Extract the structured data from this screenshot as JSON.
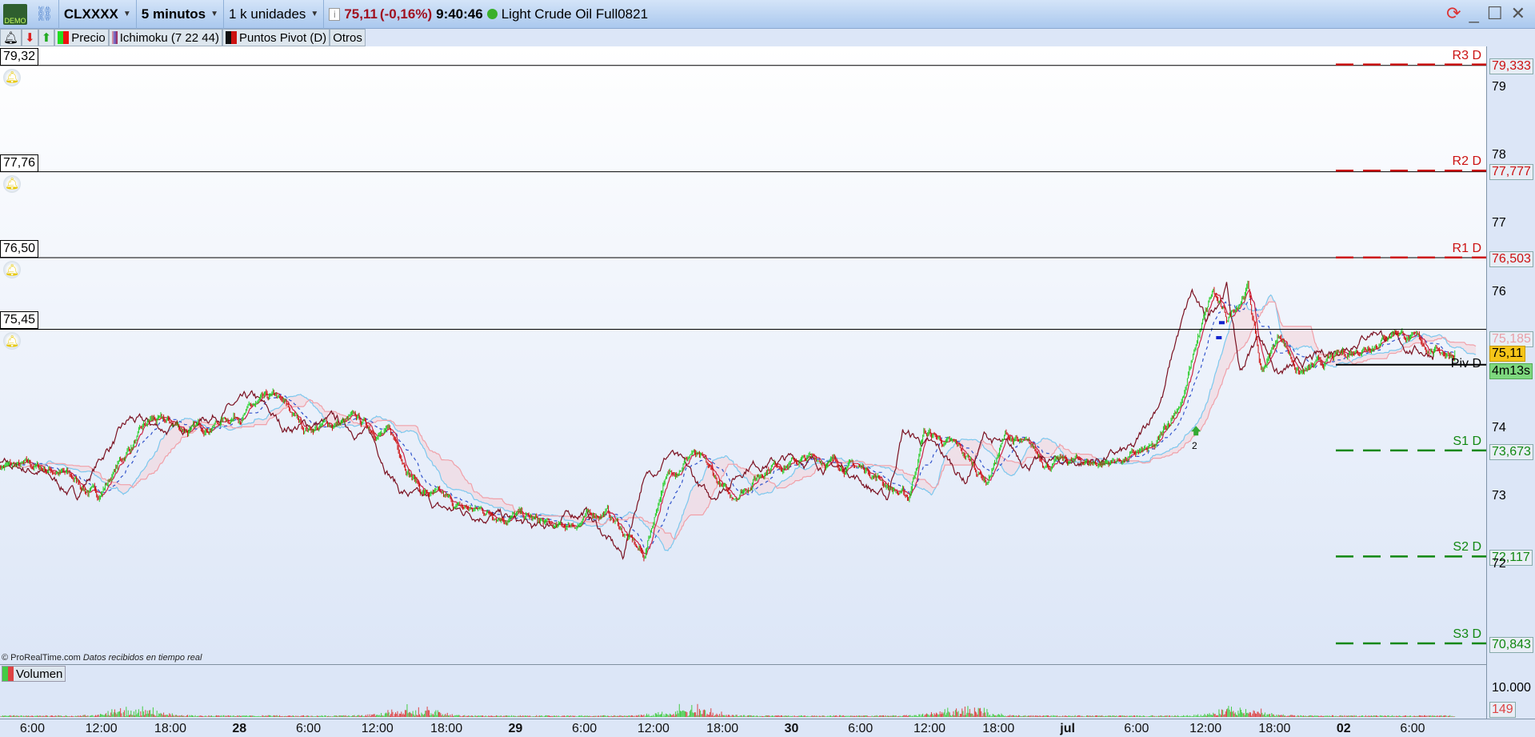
{
  "titlebar": {
    "badge": "DEMO",
    "symbol": "CLXXXX",
    "timeframe": "5 minutos",
    "units": "1 k unidades",
    "price": "75,11",
    "change": "(-0,16%)",
    "time": "9:40:46",
    "instrument": "Light Crude Oil Full0821",
    "status_color": "#3ab02a"
  },
  "toolbar": {
    "items": [
      {
        "label": "Precio",
        "colors": [
          "#22dd22",
          "#ee1111"
        ]
      },
      {
        "label": "Ichimoku (7 22 44)",
        "colors": [
          "#ee9999",
          "#6666cc"
        ]
      },
      {
        "label": "Puntos Pivot (D)",
        "colors": [
          "#111111",
          "#cc1111"
        ]
      },
      {
        "label": "Otros"
      }
    ]
  },
  "alarms": [
    {
      "label": "79,32",
      "price": 79.32
    },
    {
      "label": "77,76",
      "price": 77.76
    },
    {
      "label": "76,50",
      "price": 76.5
    },
    {
      "label": "75,45",
      "price": 75.45
    }
  ],
  "pivots": [
    {
      "label": "R3 D",
      "value": "79,333",
      "price": 79.333,
      "color": "#cc1111"
    },
    {
      "label": "R2 D",
      "value": "77,777",
      "price": 77.777,
      "color": "#cc1111"
    },
    {
      "label": "R1 D",
      "value": "76,503",
      "price": 76.503,
      "color": "#cc1111"
    },
    {
      "label": "Piv D",
      "price": 74.93,
      "color": "#000000"
    },
    {
      "label": "S1 D",
      "value": "73,673",
      "price": 73.673,
      "color": "#118811"
    },
    {
      "label": "S2 D",
      "value": "72,117",
      "price": 72.117,
      "color": "#118811"
    },
    {
      "label": "S3 D",
      "value": "70,843",
      "price": 70.843,
      "color": "#118811"
    }
  ],
  "price_axis": {
    "ticks": [
      "79",
      "78",
      "77",
      "76",
      "74",
      "73",
      "72"
    ],
    "cloud_value": "75,185",
    "last_price": "75,11",
    "countdown": "4m13s"
  },
  "volume": {
    "label": "Volumen",
    "tick": "10.000",
    "last": "149"
  },
  "copyright": "© ProRealTime.com",
  "copyright_note": "Datos recibidos en tiempo real",
  "marker": "2",
  "time_axis": [
    {
      "l": "6:00",
      "t": "27 06:00"
    },
    {
      "l": "12:00",
      "t": "27 12:00"
    },
    {
      "l": "18:00",
      "t": "27 18:00"
    },
    {
      "l": "28",
      "t": "28 00:00",
      "b": true
    },
    {
      "l": "6:00",
      "t": "28 06:00"
    },
    {
      "l": "12:00",
      "t": "28 12:00"
    },
    {
      "l": "18:00",
      "t": "28 18:00"
    },
    {
      "l": "29",
      "t": "29 00:00",
      "b": true
    },
    {
      "l": "6:00",
      "t": "29 06:00"
    },
    {
      "l": "12:00",
      "t": "29 12:00"
    },
    {
      "l": "18:00",
      "t": "29 18:00"
    },
    {
      "l": "30",
      "t": "30 00:00",
      "b": true
    },
    {
      "l": "6:00",
      "t": "30 06:00"
    },
    {
      "l": "12:00",
      "t": "30 12:00"
    },
    {
      "l": "18:00",
      "t": "30 18:00"
    },
    {
      "l": "jul",
      "t": "01 00:00",
      "b": true
    },
    {
      "l": "6:00",
      "t": "01 06:00"
    },
    {
      "l": "12:00",
      "t": "01 12:00"
    },
    {
      "l": "18:00",
      "t": "01 18:00"
    },
    {
      "l": "02",
      "t": "02 00:00",
      "b": true
    },
    {
      "l": "6:00",
      "t": "02 06:00"
    }
  ],
  "price_path": [
    {
      "t": "27 03:00",
      "p": 73.45
    },
    {
      "t": "27 08:20",
      "p": 73.38
    },
    {
      "t": "27 11:40",
      "p": 73.0
    },
    {
      "t": "27 14:15",
      "p": 73.67
    },
    {
      "t": "27 16:20",
      "p": 74.1
    },
    {
      "t": "27 20:00",
      "p": 73.96
    },
    {
      "t": "28 01:00",
      "p": 74.3
    },
    {
      "t": "28 03:10",
      "p": 74.4
    },
    {
      "t": "28 05:40",
      "p": 74.0
    },
    {
      "t": "28 10:00",
      "p": 74.1
    },
    {
      "t": "28 13:10",
      "p": 73.9
    },
    {
      "t": "28 15:50",
      "p": 73.1
    },
    {
      "t": "28 19:10",
      "p": 72.8
    },
    {
      "t": "29 00:00",
      "p": 72.74
    },
    {
      "t": "29 03:40",
      "p": 72.5
    },
    {
      "t": "29 07:50",
      "p": 72.8
    },
    {
      "t": "29 11:10",
      "p": 72.1
    },
    {
      "t": "29 12:50",
      "p": 73.2
    },
    {
      "t": "29 15:20",
      "p": 73.67
    },
    {
      "t": "29 18:40",
      "p": 72.95
    },
    {
      "t": "29 22:10",
      "p": 73.5
    },
    {
      "t": "30 02:40",
      "p": 73.55
    },
    {
      "t": "30 06:50",
      "p": 73.38
    },
    {
      "t": "30 10:10",
      "p": 72.95
    },
    {
      "t": "30 11:30",
      "p": 73.96
    },
    {
      "t": "30 14:30",
      "p": 73.67
    },
    {
      "t": "30 17:00",
      "p": 73.24
    },
    {
      "t": "30 18:40",
      "p": 73.9
    },
    {
      "t": "30 22:10",
      "p": 73.5
    },
    {
      "t": "01 03:20",
      "p": 73.5
    },
    {
      "t": "01 07:40",
      "p": 73.67
    },
    {
      "t": "01 10:10",
      "p": 74.53
    },
    {
      "t": "01 11:20",
      "p": 75.32
    },
    {
      "t": "01 12:40",
      "p": 75.97
    },
    {
      "t": "01 13:50",
      "p": 75.54
    },
    {
      "t": "01 15:40",
      "p": 76.11
    },
    {
      "t": "01 16:50",
      "p": 74.82
    },
    {
      "t": "01 18:30",
      "p": 75.39
    },
    {
      "t": "01 20:10",
      "p": 74.82
    },
    {
      "t": "01 22:00",
      "p": 74.9
    },
    {
      "t": "02 00:30",
      "p": 75.1
    },
    {
      "t": "02 04:40",
      "p": 75.47
    },
    {
      "t": "02 07:10",
      "p": 75.18
    },
    {
      "t": "02 09:40",
      "p": 75.11
    }
  ]
}
